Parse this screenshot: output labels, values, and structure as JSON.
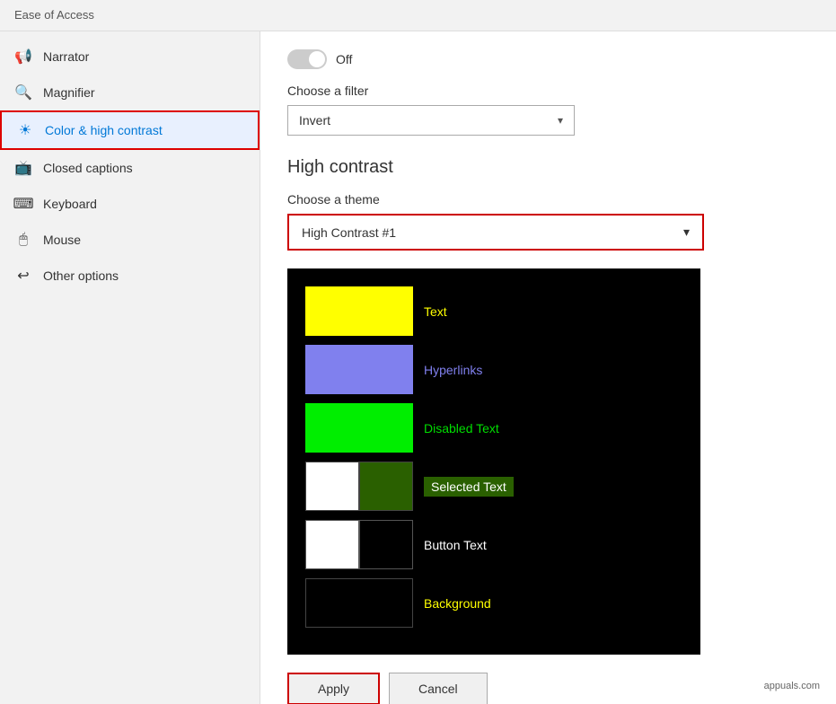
{
  "header": {
    "title": "Ease of Access"
  },
  "sidebar": {
    "items": [
      {
        "id": "narrator",
        "label": "Narrator",
        "icon": "📢"
      },
      {
        "id": "magnifier",
        "label": "Magnifier",
        "icon": "🔍"
      },
      {
        "id": "color-high-contrast",
        "label": "Color & high contrast",
        "icon": "☀",
        "active": true
      },
      {
        "id": "closed-captions",
        "label": "Closed captions",
        "icon": "📺"
      },
      {
        "id": "keyboard",
        "label": "Keyboard",
        "icon": "⌨"
      },
      {
        "id": "mouse",
        "label": "Mouse",
        "icon": "🖱"
      },
      {
        "id": "other-options",
        "label": "Other options",
        "icon": "↩"
      }
    ]
  },
  "content": {
    "toggle_label": "Off",
    "filter_label": "Choose a filter",
    "filter_value": "Invert",
    "section_title": "High contrast",
    "theme_label": "Choose a theme",
    "theme_value": "High Contrast #1",
    "preview": {
      "rows": [
        {
          "color": "#ffff00",
          "label": "Text",
          "label_color": "#ffff00",
          "type": "single"
        },
        {
          "color": "#8080ff",
          "label": "Hyperlinks",
          "label_color": "#8080ff",
          "type": "single"
        },
        {
          "color": "#00dd00",
          "label": "Disabled Text",
          "label_color": "#00dd00",
          "type": "single"
        },
        {
          "color1": "#ffffff",
          "color2": "#2a6000",
          "label": "Selected Text",
          "label_color": "#ffffff",
          "label_bg": "#2a6000",
          "type": "double"
        },
        {
          "color1": "#ffffff",
          "color2": "#000000",
          "label": "Button Text",
          "label_color": "#ffffff",
          "type": "double"
        },
        {
          "color": "#000000",
          "label": "Background",
          "label_color": "#ffff00",
          "type": "single"
        }
      ]
    },
    "buttons": {
      "apply": "Apply",
      "cancel": "Cancel"
    }
  }
}
